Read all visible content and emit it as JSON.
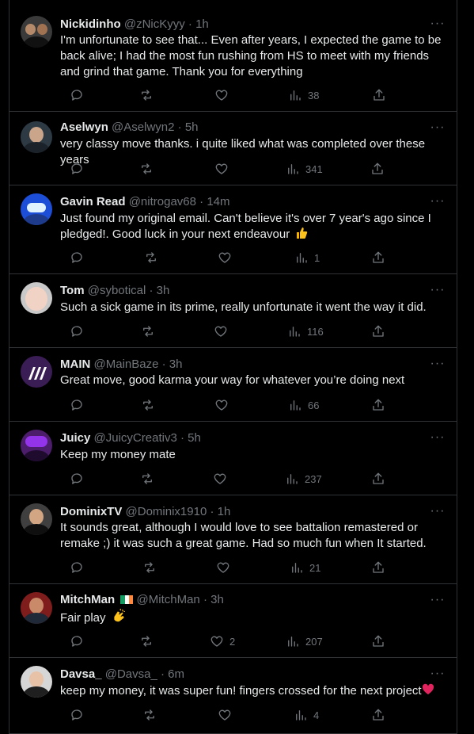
{
  "replies": [
    {
      "name": "Nickidinho",
      "handle": "@zNicKyyy",
      "sep": "·",
      "time": "1h",
      "text": "I'm unfortunate to see that... Even after years, I expected the game to be back alive; I had the most fun rushing from HS to meet with my friends and grind that game. Thank you for everything",
      "likes": "",
      "views": "38",
      "avatar_color": "#3a3a3a"
    },
    {
      "name": "Aselwyn",
      "handle": "@Aselwyn2",
      "sep": "·",
      "time": "5h",
      "text": "very classy move thanks. i quite liked what was completed over these years",
      "likes": "",
      "views": "341",
      "avatar_color": "#2d3a44"
    },
    {
      "name": "Gavin Read",
      "handle": "@nitrogav68",
      "sep": "·",
      "time": "14m",
      "text": "Just found my original email. Can't believe it's over 7 year's ago since I pledged!. Good luck in your next endeavour",
      "emoji": "thumbs-up",
      "likes": "",
      "views": "1",
      "avatar_color": "#1d4ed8"
    },
    {
      "name": "Tom",
      "handle": "@sybotical",
      "sep": "·",
      "time": "3h",
      "text": "Such a sick game in its prime, really unfortunate it went the way it did.",
      "likes": "",
      "views": "116",
      "avatar_color": "#c9c9c9"
    },
    {
      "name": "MAIN",
      "handle": "@MainBaze",
      "sep": "·",
      "time": "3h",
      "text": "Great move, good karma your way for whatever you’re doing next",
      "likes": "",
      "views": "66",
      "avatar_color": "#3b1d55"
    },
    {
      "name": "Juicy",
      "handle": "@JuicyCreativ3",
      "sep": "·",
      "time": "5h",
      "text": "Keep my money mate",
      "likes": "",
      "views": "237",
      "avatar_color": "#4c1d6b"
    },
    {
      "name": "DominixTV",
      "handle": "@Dominix1910",
      "sep": "·",
      "time": "1h",
      "text": "It sounds great, although I would love to see battalion remastered or remake ;) it was such a great game. Had so much fun when It started.",
      "likes": "",
      "views": "21",
      "avatar_color": "#3f3f3f"
    },
    {
      "name": "MitchMan",
      "handle": "@MitchMan",
      "sep": "·",
      "time": "3h",
      "text": "Fair play",
      "emoji": "clapping-hands",
      "flag": "ireland-flag",
      "likes": "2",
      "views": "207",
      "avatar_color": "#7f1d1d"
    },
    {
      "name": "Davsa_",
      "handle": "@Davsa_",
      "sep": "·",
      "time": "6m",
      "text": "keep my money, it was super fun! fingers crossed for the next project",
      "emoji": "red-heart",
      "likes": "",
      "views": "4",
      "avatar_color": "#d6d6d6"
    }
  ],
  "icons": {
    "more": "more-icon",
    "reply": "reply-icon",
    "repost": "repost-icon",
    "like": "like-icon",
    "views": "views-icon",
    "share": "share-icon"
  },
  "colors": {
    "background": "#000000",
    "text": "#e7e9ea",
    "muted": "#71767b",
    "border": "#2f3336"
  }
}
